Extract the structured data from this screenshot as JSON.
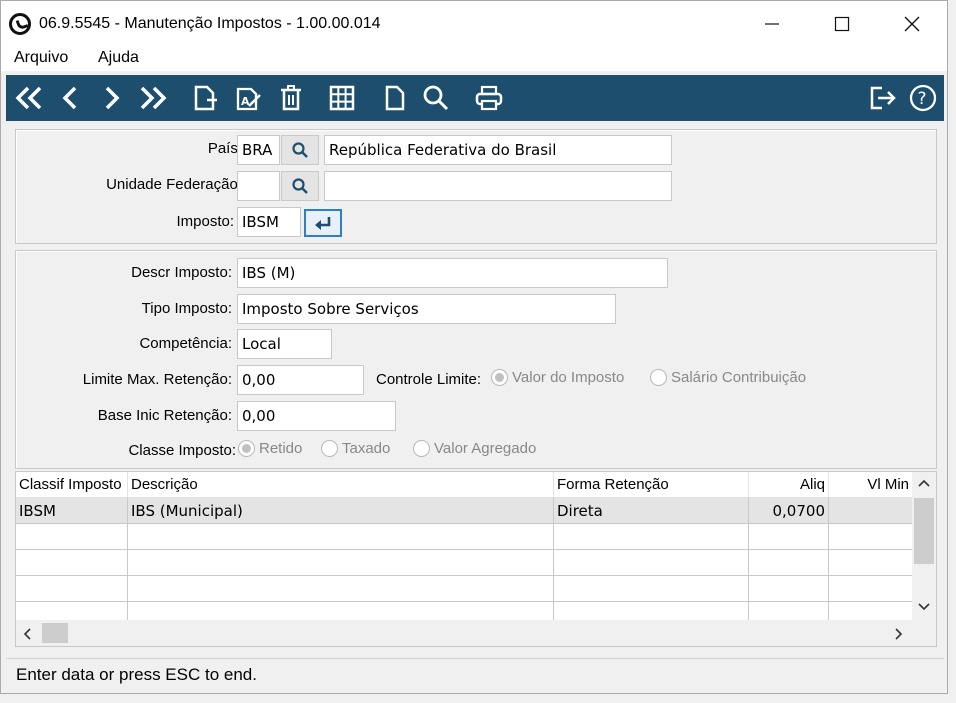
{
  "window": {
    "title": "06.9.5545 - Manutenção Impostos - 1.00.00.014"
  },
  "menu": {
    "items": [
      "Arquivo",
      "Ajuda"
    ]
  },
  "header_form": {
    "pais_label": "País:",
    "pais_code": "BRA",
    "pais_name": "República Federativa do Brasil",
    "uf_label": "Unidade Federação:",
    "uf_code": "",
    "uf_name": "",
    "imposto_label": "Imposto:",
    "imposto_code": "IBSM"
  },
  "detail_form": {
    "descr_label": "Descr  Imposto:",
    "descr_value": "IBS (M)",
    "tipo_label": "Tipo Imposto:",
    "tipo_value": "Imposto Sobre Serviços",
    "competencia_label": "Competência:",
    "competencia_value": "Local",
    "limite_label": "Limite Max. Retenção:",
    "limite_value": "0,00",
    "controle_label": "Controle Limite:",
    "controle_options": [
      "Valor do Imposto",
      "Salário Contribuição"
    ],
    "base_label": "Base Inic Retenção:",
    "base_value": "0,00",
    "classe_label": "Classe Imposto:",
    "classe_options": [
      "Retido",
      "Taxado",
      "Valor Agregado"
    ]
  },
  "grid": {
    "headers": [
      "Classif Imposto",
      "Descrição",
      "Forma Retenção",
      "Aliq",
      "Vl Min"
    ],
    "rows": [
      [
        "IBSM",
        "IBS (Municipal)",
        "Direta",
        "0,0700",
        ""
      ]
    ]
  },
  "status": {
    "text": "Enter data or press ESC to end."
  },
  "colors": {
    "toolbar": "#1d4e6e",
    "button_blue": "#1d4e6e"
  },
  "icons": [
    "first-icon",
    "prev-icon",
    "next-icon",
    "last-icon",
    "new-icon",
    "edit-icon",
    "delete-icon",
    "grid-icon",
    "copy-icon",
    "search-icon",
    "print-icon",
    "exit-icon",
    "help-icon"
  ]
}
